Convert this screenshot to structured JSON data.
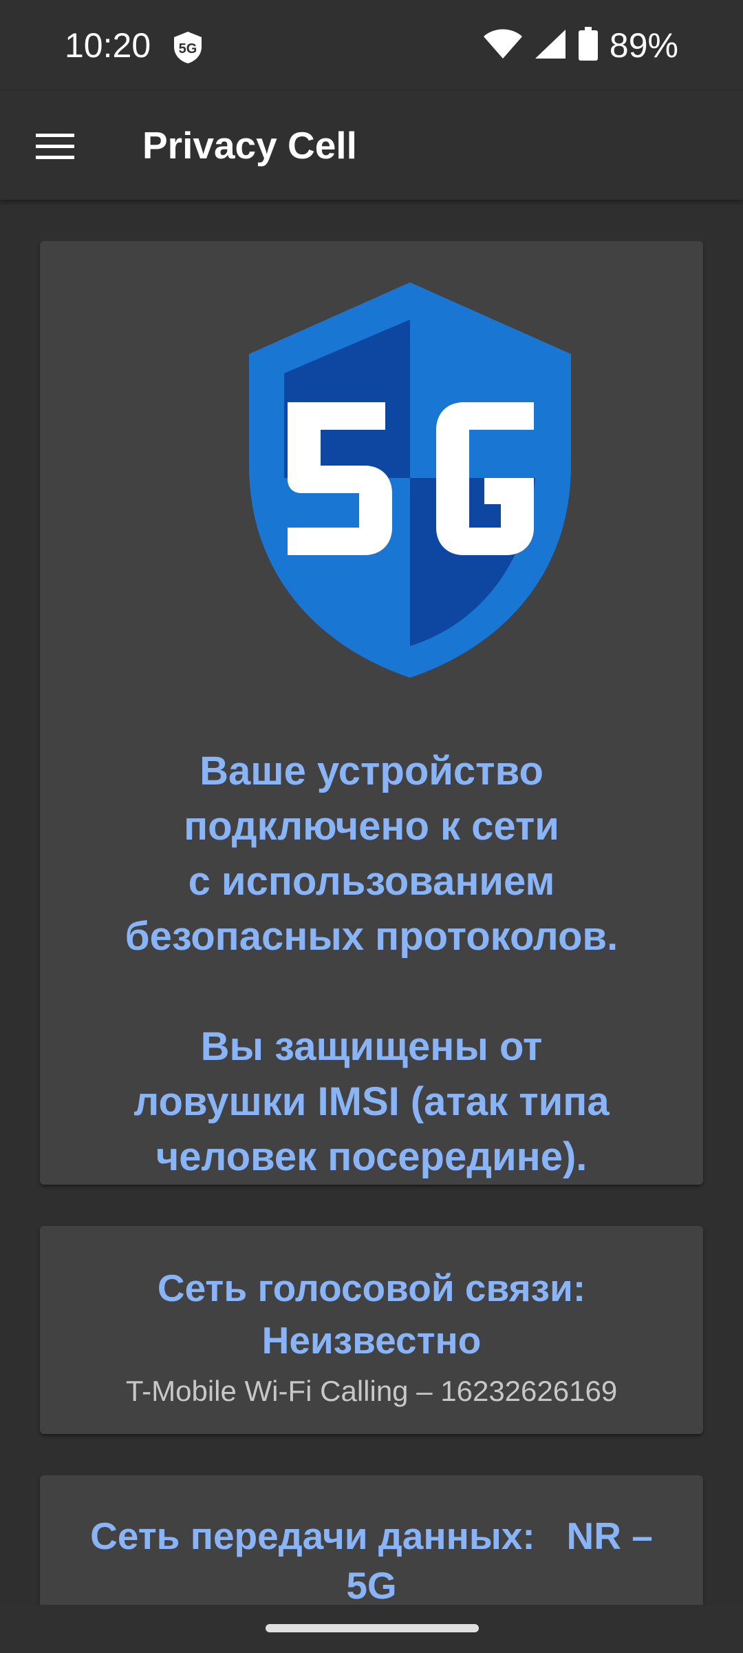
{
  "status_bar": {
    "time": "10:20",
    "battery_percent": "89%",
    "icons": [
      "5g-shield-icon",
      "wifi-icon",
      "cell-signal-icon",
      "battery-icon"
    ]
  },
  "app_bar": {
    "title": "Privacy Cell",
    "menu_icon": "hamburger-menu-icon"
  },
  "status_card": {
    "icon": "5g-shield-icon",
    "line1": "Ваше устройство",
    "line2": "подключено к сети",
    "line3": "с использованием",
    "line4": "безопасных протоколов.",
    "line5": "Вы защищены от",
    "line6": "ловушки IMSI (атак типа",
    "line7": "человек посередине)."
  },
  "voice_card": {
    "title_line1": "Сеть голосовой связи:",
    "title_line2": "Неизвестно",
    "detail": "T-Mobile Wi-Fi Calling – 16232626169"
  },
  "data_card": {
    "title_line1": "Сеть передачи данных:   NR –",
    "title_line2": "5G"
  },
  "colors": {
    "background": "#303030",
    "card": "#424242",
    "accent_text": "#8ab4f8",
    "shield_light": "#1976d2",
    "shield_dark": "#0d47a1"
  }
}
